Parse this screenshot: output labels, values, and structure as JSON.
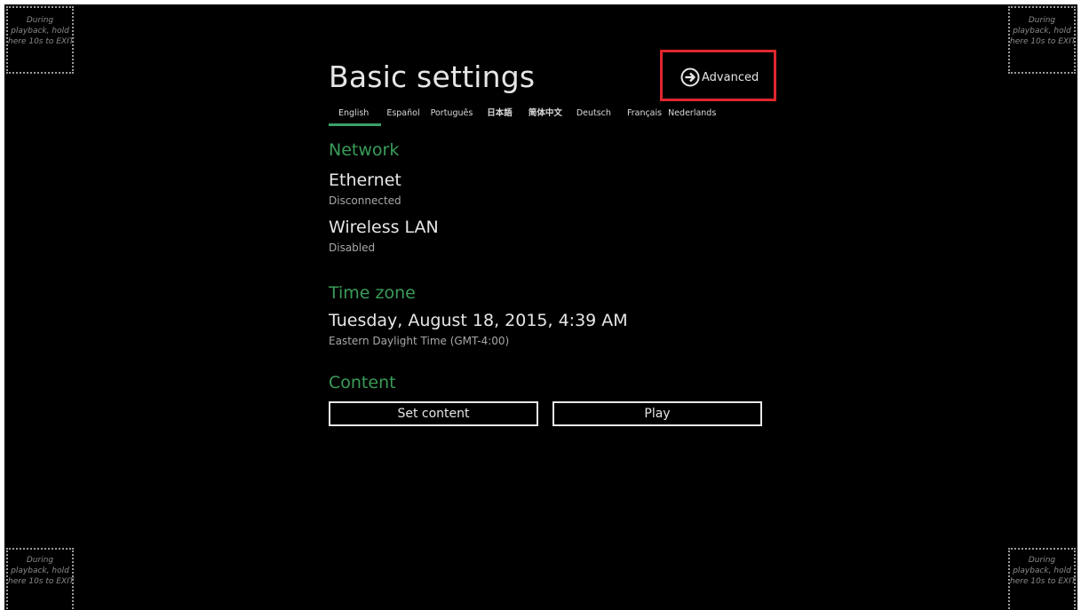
{
  "exit_hint": {
    "line1": "During",
    "line2": "playback, hold",
    "line3": "here 10s to EXIT"
  },
  "header": {
    "title": "Basic settings",
    "advanced_label": "Advanced",
    "advanced_icon": "arrow-right-circle-icon"
  },
  "languages": [
    {
      "label": "English",
      "active": true
    },
    {
      "label": "Español",
      "active": false
    },
    {
      "label": "Português",
      "active": false
    },
    {
      "label": "日本語",
      "active": false
    },
    {
      "label": "简体中文",
      "active": false
    },
    {
      "label": "Deutsch",
      "active": false
    },
    {
      "label": "Français",
      "active": false
    },
    {
      "label": "Nederlands",
      "active": false
    }
  ],
  "network": {
    "heading": "Network",
    "ethernet_label": "Ethernet",
    "ethernet_status": "Disconnected",
    "wireless_label": "Wireless LAN",
    "wireless_status": "Disabled"
  },
  "timezone": {
    "heading": "Time zone",
    "datetime": "Tuesday, August 18, 2015, 4:39 AM",
    "zone": "Eastern Daylight Time (GMT-4:00)"
  },
  "content": {
    "heading": "Content",
    "set_content_label": "Set content",
    "play_label": "Play"
  },
  "colors": {
    "background": "#000000",
    "accent": "#3a9c58",
    "highlight": "#e0262e"
  }
}
